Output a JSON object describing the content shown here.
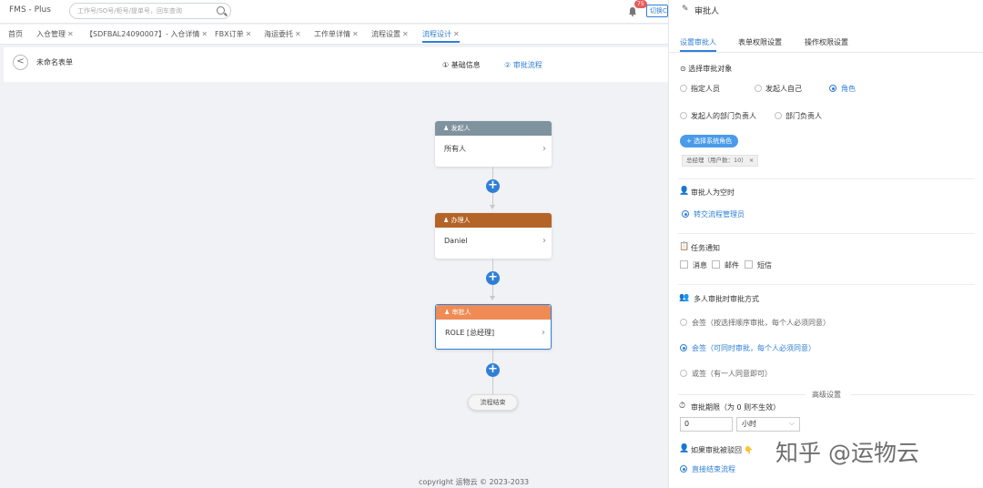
{
  "app": {
    "title": "FMS - Plus"
  },
  "search": {
    "placeholder": "工作号/SO号/柜号/提单号，回车查询"
  },
  "notify": {
    "count": "75",
    "switch_label": "切换C"
  },
  "tabs": [
    {
      "label": "首页",
      "closable": false
    },
    {
      "label": "入仓管理",
      "closable": true
    },
    {
      "label": "【SDFBAL24090007】- 入仓详情",
      "closable": true
    },
    {
      "label": "FBX订单",
      "closable": true
    },
    {
      "label": "海运委托",
      "closable": true
    },
    {
      "label": "工作单详情",
      "closable": true
    },
    {
      "label": "流程设置",
      "closable": true
    },
    {
      "label": "流程设计",
      "closable": true,
      "active": true
    }
  ],
  "subheader": {
    "back": "<",
    "form_name": "未命名表单",
    "step1": "① 基础信息",
    "step2": "② 审批流程"
  },
  "flow": {
    "start": {
      "title": "发起人",
      "value": "所有人",
      "color": "#7f939e"
    },
    "handler": {
      "title": "办理人",
      "value": "Daniel",
      "color": "#b46426"
    },
    "approver": {
      "title": "审批人",
      "value": "ROLE [总经理]",
      "color": "#f08b55"
    },
    "end": "流程结束"
  },
  "copyright": "copyright 运物云 © 2023-2033",
  "panel": {
    "title": "审批人",
    "tabs": [
      "设置审批人",
      "表单权限设置",
      "操作权限设置"
    ],
    "select_target": "选择审批对象",
    "options": [
      "指定人员",
      "发起人自己",
      "角色",
      "发起人的部门负责人",
      "部门负责人"
    ],
    "select_role_button": "+ 选择系统角色",
    "role_tag": "总经理（用户数：10）",
    "empty_title": "审批人为空时",
    "empty_option": "转交流程管理员",
    "notice_title": "任务通知",
    "notice_options": [
      "消息",
      "邮件",
      "短信"
    ],
    "multi_title": "多人审批时审批方式",
    "multi_options": [
      "会签（按选择顺序审批，每个人必须同意）",
      "会签（可同时审批，每个人必须同意）",
      "或签（有一人同意即可）"
    ],
    "advanced": "高级设置",
    "deadline_title": "审批期限（为 0 则不生效）",
    "deadline_value": "0",
    "deadline_unit": "小时",
    "rejected_title": "如果审批被驳回",
    "rejected_option": "直接结束流程"
  },
  "watermark": "知乎 @运物云",
  "colors": {
    "accent": "#2f7fd6"
  }
}
